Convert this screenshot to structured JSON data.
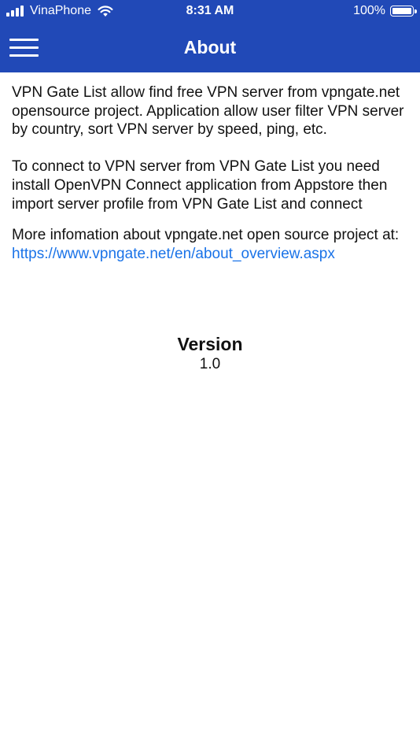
{
  "status_bar": {
    "carrier": "VinaPhone",
    "time": "8:31 AM",
    "battery": "100%"
  },
  "header": {
    "title": "About",
    "menu_icon": "hamburger-menu-icon",
    "color": "#2149b7"
  },
  "content": {
    "paragraph1": "VPN Gate List allow find free VPN server from vpngate.net opensource project. Application allow user filter VPN server by country, sort VPN server by speed, ping, etc.",
    "paragraph2": "To connect to VPN server from VPN Gate List you need install OpenVPN Connect application from Appstore then import server profile from VPN Gate List and connect",
    "paragraph3": "More infomation about vpngate.net open source project at:",
    "link": "https://www.vpngate.net/en/about_overview.aspx",
    "link_color": "#1a73e8"
  },
  "version": {
    "label": "Version",
    "value": "1.0"
  }
}
